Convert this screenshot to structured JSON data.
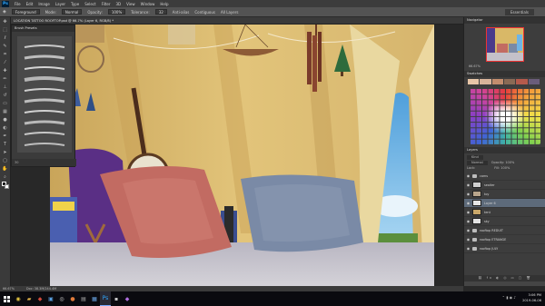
{
  "menubar": {
    "logo": "Ps",
    "items": [
      "File",
      "Edit",
      "Image",
      "Layer",
      "Type",
      "Select",
      "Filter",
      "3D",
      "View",
      "Window",
      "Help"
    ]
  },
  "options": {
    "tool_label": "Foreground",
    "mode_label": "Mode:",
    "mode_value": "Normal",
    "opacity_label": "Opacity:",
    "opacity_value": "100%",
    "tolerance_label": "Tolerance:",
    "tolerance_value": "32",
    "antialias": "Anti-alias",
    "contiguous": "Contiguous",
    "all_layers": "All Layers",
    "workspace": "Essentials"
  },
  "document": {
    "tab_title": "LOCATION TATTOO ROOFTOP.psd @ 66.7% (Layer 6, RGB/8) *",
    "zoom": "66.67%",
    "doc_size": "Doc: 38.3M/244.4M"
  },
  "brush_panel": {
    "title": "Brush Presets",
    "footer_size": "30"
  },
  "navigator": {
    "title": "Navigator",
    "zoom": "66.67%"
  },
  "swatches": {
    "title": "Swatches",
    "top_row": [
      "#e8c6a8",
      "#d9b49a",
      "#c48d6e",
      "#8a6a55",
      "#b55a4c",
      "#6b5d7a"
    ]
  },
  "layers": {
    "title": "Layers",
    "kind_label": "Kind",
    "blend_mode": "Normal",
    "opacity_label": "Opacity:",
    "opacity_value": "100%",
    "lock_label": "Lock:",
    "fill_label": "Fill:",
    "fill_value": "100%",
    "rows": [
      {
        "name": "cams",
        "type": "folder",
        "selected": false,
        "color": ""
      },
      {
        "name": "seaiter",
        "type": "layer",
        "selected": false,
        "color": "#cfcfcf"
      },
      {
        "name": "toy",
        "type": "layer",
        "selected": false,
        "color": "#b8a58c"
      },
      {
        "name": "Layer 6",
        "type": "layer",
        "selected": true,
        "color": "#e6e6e6"
      },
      {
        "name": "tent",
        "type": "layer",
        "selected": false,
        "color": "#caa86a"
      },
      {
        "name": "sky",
        "type": "layer",
        "selected": false,
        "color": "#e3e3e3"
      },
      {
        "name": "rooftop REDUIT",
        "type": "folder",
        "selected": false,
        "color": ""
      },
      {
        "name": "rooftop ETRANGE",
        "type": "folder",
        "selected": false,
        "color": ""
      },
      {
        "name": "rooftop JULY",
        "type": "folder",
        "selected": false,
        "color": ""
      }
    ]
  },
  "taskbar": {
    "apps": [
      "chrome",
      "folder",
      "app",
      "ps",
      "steam",
      "app2",
      "app3",
      "app4",
      "photoshop",
      "app5",
      "app6"
    ],
    "time": "3:06 PM",
    "date": "2019-06-06"
  },
  "colors": {
    "tent": "#d9b867",
    "pillow_red": "#c26b62",
    "pillow_blue": "#7a8aa6",
    "purple": "#5a2f85",
    "floor": "#c4c1c9",
    "sky": "#6fb4e6"
  }
}
